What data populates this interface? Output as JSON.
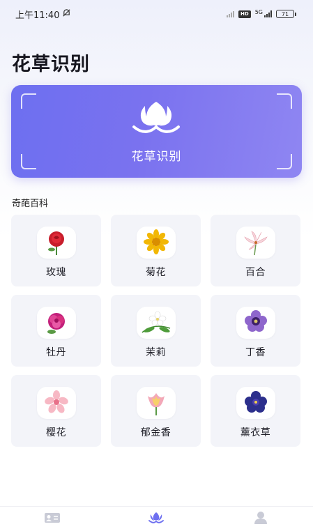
{
  "status_bar": {
    "time": "上午11:40",
    "network": "5G",
    "hd_badge": "HD",
    "battery": "71"
  },
  "page_title": "花草识别",
  "banner": {
    "label": "花草识别",
    "icon": "tulip-icon",
    "gradient": [
      "#6d6ff0",
      "#8f86f2"
    ]
  },
  "section_title": "奇葩百科",
  "flowers": [
    {
      "name": "玫瑰",
      "icon": "rose-icon"
    },
    {
      "name": "菊花",
      "icon": "chrysanthemum-icon"
    },
    {
      "name": "百合",
      "icon": "lily-icon"
    },
    {
      "name": "牡丹",
      "icon": "peony-icon"
    },
    {
      "name": "茉莉",
      "icon": "jasmine-icon"
    },
    {
      "name": "丁香",
      "icon": "lilac-icon"
    },
    {
      "name": "樱花",
      "icon": "cherry-blossom-icon"
    },
    {
      "name": "郁金香",
      "icon": "tulip-icon"
    },
    {
      "name": "薰衣草",
      "icon": "lavender-icon"
    }
  ],
  "tabbar": {
    "items": [
      {
        "icon": "id-card-icon",
        "active": false
      },
      {
        "icon": "flower-icon",
        "active": true
      },
      {
        "icon": "user-icon",
        "active": false
      }
    ],
    "active_color": "#6d6ff0",
    "inactive_color": "#c9cbd6"
  }
}
